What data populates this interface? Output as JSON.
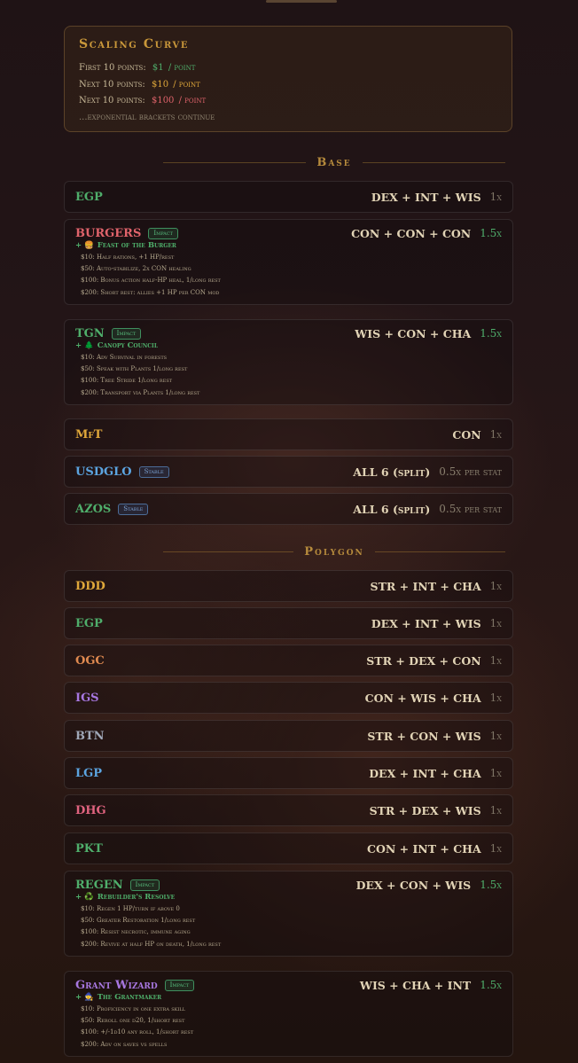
{
  "colors": {
    "gold": "#c9973a",
    "green": "#4fae6b",
    "red": "#e0636b",
    "yellow": "#e0a83a",
    "blue": "#5ba4e0",
    "purple": "#a777e0",
    "orange": "#e08a50",
    "gray": "#a0a8b8",
    "pink": "#e0637f"
  },
  "scaling": {
    "title": "Scaling Curve",
    "lines": [
      {
        "label": "First 10 points:",
        "price": "$1",
        "unit": "/ point",
        "color": "#4fae6b"
      },
      {
        "label": "Next 10 points:",
        "price": "$10",
        "unit": "/ point",
        "color": "#e0a83a"
      },
      {
        "label": "Next 10 points:",
        "price": "$100",
        "unit": "/ point",
        "color": "#e0636b"
      }
    ],
    "note": "...exponential brackets continue"
  },
  "sections": {
    "base": "Base",
    "polygon": "Polygon"
  },
  "base_rows": [
    {
      "ticker": "EGP",
      "stats": "DEX + INT + WIS",
      "mult": "1x"
    },
    {
      "ticker": "BURGERS",
      "badge": "Impact",
      "stats": "CON + CON + CON",
      "mult": "1.5x",
      "perk": {
        "icon": "🍔",
        "title": "Feast of the Burger",
        "lines": [
          "$10: Half rations, +1 HP/rest",
          "$50: Auto-stabilize, 2x CON healing",
          "$100: Bonus action half-HP heal, 1/long rest",
          "$200: Short rest: allies +1 HP per CON mod"
        ]
      }
    },
    {
      "ticker": "TGN",
      "badge": "Impact",
      "stats": "WIS + CON + CHA",
      "mult": "1.5x",
      "perk": {
        "icon": "🌲",
        "title": "Canopy Council",
        "lines": [
          "$10: Adv Survival in forests",
          "$50: Speak with Plants 1/long rest",
          "$100: Tree Stride 1/long rest",
          "$200: Transport via Plants 1/long rest"
        ]
      }
    },
    {
      "ticker": "MfT",
      "stats": "CON",
      "mult": "1x"
    },
    {
      "ticker": "USDGLO",
      "badge": "Stable",
      "stats": "ALL 6 (split)",
      "mult": "0.5x per stat"
    },
    {
      "ticker": "AZOS",
      "badge": "Stable",
      "stats": "ALL 6 (split)",
      "mult": "0.5x per stat"
    }
  ],
  "polygon_rows": [
    {
      "ticker": "DDD",
      "stats": "STR + INT + CHA",
      "mult": "1x"
    },
    {
      "ticker": "EGP",
      "stats": "DEX + INT + WIS",
      "mult": "1x"
    },
    {
      "ticker": "OGC",
      "stats": "STR + DEX + CON",
      "mult": "1x"
    },
    {
      "ticker": "IGS",
      "stats": "CON + WIS + CHA",
      "mult": "1x"
    },
    {
      "ticker": "BTN",
      "stats": "STR + CON + WIS",
      "mult": "1x"
    },
    {
      "ticker": "LGP",
      "stats": "DEX + INT + CHA",
      "mult": "1x"
    },
    {
      "ticker": "DHG",
      "stats": "STR + DEX + WIS",
      "mult": "1x"
    },
    {
      "ticker": "PKT",
      "stats": "CON + INT + CHA",
      "mult": "1x"
    },
    {
      "ticker": "REGEN",
      "badge": "Impact",
      "stats": "DEX + CON + WIS",
      "mult": "1.5x",
      "perk": {
        "icon": "♻️",
        "title": "Rebuilder's Resolve",
        "lines": [
          "$10: Regen 1 HP/turn if above 0",
          "$50: Greater Restoration 1/long rest",
          "$100: Resist necrotic, immune aging",
          "$200: Revive at half HP on death, 1/long rest"
        ]
      }
    },
    {
      "ticker": "Grant Wizard",
      "badge": "Impact",
      "stats": "WIS + CHA + INT",
      "mult": "1.5x",
      "perk": {
        "icon": "🧙",
        "title": "The Grantmaker",
        "lines": [
          "$10: Proficiency in one extra skill",
          "$50: Reroll one d20, 1/short rest",
          "$100: +/-1d10 any roll, 1/short rest",
          "$200: Adv on saves vs spells"
        ]
      }
    }
  ]
}
